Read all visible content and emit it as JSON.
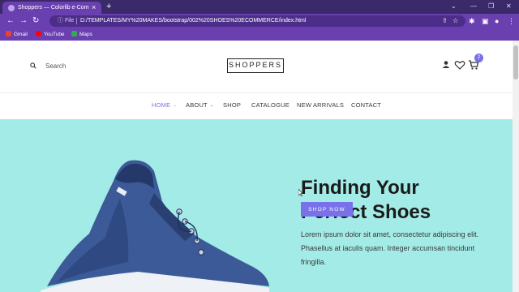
{
  "browser": {
    "tab_title": "Shoppers — Colorlib e-Commerce",
    "tab_close": "×",
    "new_tab": "+",
    "window_controls": [
      "⌄",
      "—",
      "❐",
      "✕"
    ],
    "back": "←",
    "forward": "→",
    "reload": "↻",
    "file_label": "ⓘ File",
    "url": "D:/TEMPLATES/MY%20MAKES/bootstrap/002%20SHOES%20ECOMMERCE/index.html",
    "omnibox_icons": [
      "⇪",
      "☆"
    ],
    "toolbar_icons": [
      "✱",
      "▣",
      "●",
      "⋮"
    ],
    "bookmarks": [
      {
        "label": "Gmail",
        "color": "#ea4335"
      },
      {
        "label": "YouTube",
        "color": "#ff0000"
      },
      {
        "label": "Maps",
        "color": "#34a853"
      }
    ]
  },
  "header": {
    "search_placeholder": "Search",
    "logo": "SHOPPERS",
    "cart_count": "2",
    "icons": [
      "search-icon",
      "user-icon",
      "heart-icon",
      "cart-icon"
    ]
  },
  "nav": {
    "items": [
      {
        "label": "HOME",
        "has_caret": true,
        "active": true
      },
      {
        "label": "ABOUT",
        "has_caret": true,
        "active": false
      },
      {
        "label": "SHOP",
        "has_caret": false,
        "active": false
      },
      {
        "label": "CATALOGUE",
        "has_caret": false,
        "active": false
      },
      {
        "label": "NEW ARRIVALS",
        "has_caret": false,
        "active": false
      },
      {
        "label": "CONTACT",
        "has_caret": false,
        "active": false
      }
    ],
    "caret": "⌄"
  },
  "hero": {
    "title_line1": "Finding Your",
    "title_line2": "Perfect Shoes",
    "text": "Lorem ipsum dolor sit amet, consectetur adipiscing elit. Phasellus at iaculis quam. Integer accumsan tincidunt fringilla.",
    "button": "SHOP NOW"
  },
  "colors": {
    "accent": "#7971ea",
    "hero_bg": "#a3ebe6",
    "browser_purple": "#6a3fb0"
  }
}
